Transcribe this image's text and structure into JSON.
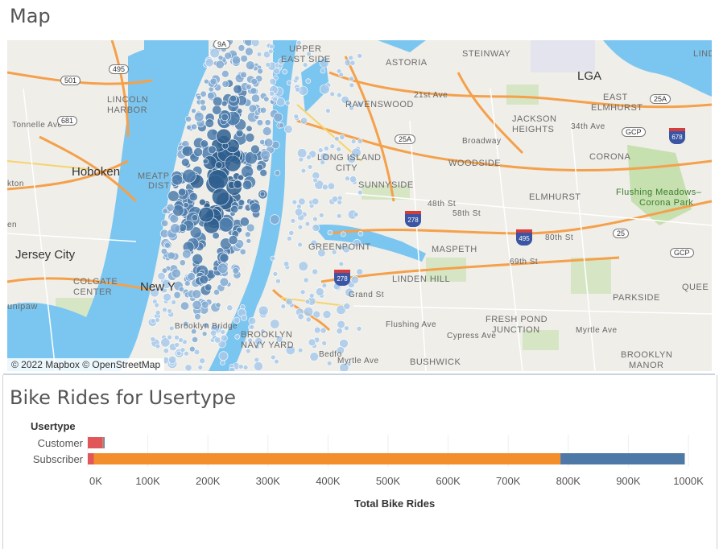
{
  "map_panel": {
    "title": "Map",
    "attribution": "© 2022 Mapbox © OpenStreetMap",
    "labels": [
      {
        "text": "STEINWAY",
        "x": 565,
        "y": 11,
        "style": ""
      },
      {
        "text": "LINDI",
        "x": 852,
        "y": 11,
        "style": ""
      },
      {
        "text": "ASTORIA",
        "x": 470,
        "y": 22,
        "style": ""
      },
      {
        "text": "UPPER",
        "x": 350,
        "y": 5,
        "style": ""
      },
      {
        "text": "EAST SIDE",
        "x": 340,
        "y": 18,
        "style": ""
      },
      {
        "text": "LGA",
        "x": 708,
        "y": 36,
        "style": "big"
      },
      {
        "text": "LINCOLN",
        "x": 124,
        "y": 68,
        "style": ""
      },
      {
        "text": "HARBOR",
        "x": 124,
        "y": 81,
        "style": ""
      },
      {
        "text": "RAVENSWOOD",
        "x": 420,
        "y": 74,
        "style": ""
      },
      {
        "text": "EAST",
        "x": 740,
        "y": 65,
        "style": ""
      },
      {
        "text": "ELMHURST",
        "x": 725,
        "y": 78,
        "style": ""
      },
      {
        "text": "JACKSON",
        "x": 627,
        "y": 92,
        "style": ""
      },
      {
        "text": "HEIGHTS",
        "x": 627,
        "y": 105,
        "style": ""
      },
      {
        "text": "34th Ave",
        "x": 700,
        "y": 102,
        "style": "street"
      },
      {
        "text": "Broadway",
        "x": 565,
        "y": 120,
        "style": "street"
      },
      {
        "text": "Hoboken",
        "x": 80,
        "y": 155,
        "style": "big"
      },
      {
        "text": "LONG ISLAND",
        "x": 385,
        "y": 140,
        "style": ""
      },
      {
        "text": "CITY",
        "x": 408,
        "y": 153,
        "style": ""
      },
      {
        "text": "WOODSIDE",
        "x": 548,
        "y": 147,
        "style": ""
      },
      {
        "text": "CORONA",
        "x": 723,
        "y": 139,
        "style": ""
      },
      {
        "text": "MEATP",
        "x": 162,
        "y": 163,
        "style": ""
      },
      {
        "text": "DIST",
        "x": 175,
        "y": 175,
        "style": ""
      },
      {
        "text": "SUNNYSIDE",
        "x": 436,
        "y": 174,
        "style": ""
      },
      {
        "text": "ELMHURST",
        "x": 648,
        "y": 189,
        "style": ""
      },
      {
        "text": "Flushing Meadows–",
        "x": 756,
        "y": 183,
        "style": "green"
      },
      {
        "text": "Corona Park",
        "x": 785,
        "y": 196,
        "style": "green"
      },
      {
        "text": "Jersey City",
        "x": 10,
        "y": 258,
        "style": "big"
      },
      {
        "text": "GREENPOINT",
        "x": 374,
        "y": 251,
        "style": ""
      },
      {
        "text": "MASPETH",
        "x": 527,
        "y": 254,
        "style": ""
      },
      {
        "text": "COLGATE",
        "x": 82,
        "y": 294,
        "style": ""
      },
      {
        "text": "CENTER",
        "x": 82,
        "y": 307,
        "style": ""
      },
      {
        "text": "LINDEN HILL",
        "x": 478,
        "y": 291,
        "style": ""
      },
      {
        "text": "PARKSIDE",
        "x": 752,
        "y": 314,
        "style": ""
      },
      {
        "text": "QUEE",
        "x": 838,
        "y": 301,
        "style": ""
      },
      {
        "text": "unipaw",
        "x": 0,
        "y": 325,
        "style": ""
      },
      {
        "text": "FRESH POND",
        "x": 594,
        "y": 341,
        "style": ""
      },
      {
        "text": "JUNCTION",
        "x": 602,
        "y": 354,
        "style": ""
      },
      {
        "text": "Myrtle Ave",
        "x": 706,
        "y": 355,
        "style": "street"
      },
      {
        "text": "Flushing Ave",
        "x": 470,
        "y": 348,
        "style": "street"
      },
      {
        "text": "Cypress Ave",
        "x": 546,
        "y": 362,
        "style": "street"
      },
      {
        "text": "BROOKLYN",
        "x": 290,
        "y": 360,
        "style": ""
      },
      {
        "text": "NAVY YARD",
        "x": 290,
        "y": 373,
        "style": ""
      },
      {
        "text": "BROOKLYN",
        "x": 762,
        "y": 385,
        "style": ""
      },
      {
        "text": "MANOR",
        "x": 772,
        "y": 398,
        "style": ""
      },
      {
        "text": "BUSHWICK",
        "x": 500,
        "y": 394,
        "style": ""
      },
      {
        "text": "Myrtle Ave",
        "x": 410,
        "y": 393,
        "style": "street"
      },
      {
        "text": "Brooklyn Bridge",
        "x": 208,
        "y": 350,
        "style": "street"
      },
      {
        "text": "Grand St",
        "x": 424,
        "y": 311,
        "style": "street"
      },
      {
        "text": "48th St",
        "x": 522,
        "y": 198,
        "style": "street"
      },
      {
        "text": "58th St",
        "x": 553,
        "y": 210,
        "style": "street"
      },
      {
        "text": "80th St",
        "x": 668,
        "y": 240,
        "style": "street"
      },
      {
        "text": "69th St",
        "x": 624,
        "y": 270,
        "style": "street"
      },
      {
        "text": "Tonnelle Ave",
        "x": 6,
        "y": 100,
        "style": "street"
      },
      {
        "text": "kton",
        "x": 0,
        "y": 173,
        "style": "street"
      },
      {
        "text": "en",
        "x": 0,
        "y": 224,
        "style": "street"
      },
      {
        "text": "New Y",
        "x": 165,
        "y": 298,
        "style": "big"
      },
      {
        "text": "Bedfo",
        "x": 387,
        "y": 385,
        "style": "street"
      },
      {
        "text": "21st Ave",
        "x": 505,
        "y": 63,
        "style": "street"
      }
    ],
    "shields": [
      {
        "text": "9A",
        "x": 256,
        "y": -1
      },
      {
        "text": "495",
        "x": 126,
        "y": 30
      },
      {
        "text": "501",
        "x": 66,
        "y": 44
      },
      {
        "text": "681",
        "x": 62,
        "y": 94
      },
      {
        "text": "25A",
        "x": 798,
        "y": 67
      },
      {
        "text": "GCP",
        "x": 763,
        "y": 108
      },
      {
        "text": "25A",
        "x": 481,
        "y": 117
      },
      {
        "text": "25",
        "x": 752,
        "y": 234
      },
      {
        "text": "GCP",
        "x": 823,
        "y": 258
      }
    ],
    "interstates": [
      {
        "text": "278",
        "x": 494,
        "y": 212
      },
      {
        "text": "495",
        "x": 632,
        "y": 235
      },
      {
        "text": "678",
        "x": 822,
        "y": 109
      },
      {
        "text": "278",
        "x": 406,
        "y": 285
      }
    ]
  },
  "chart_panel": {
    "title": "Bike Rides for Usertype",
    "legend_title": "Usertype"
  },
  "chart_data": {
    "type": "bar",
    "orientation": "horizontal",
    "stacked": true,
    "categories": [
      "Customer",
      "Subscriber"
    ],
    "series": [
      {
        "color": "#e15759",
        "values": [
          25000,
          10000
        ]
      },
      {
        "color": "#f28e2b",
        "values": [
          1000,
          777000
        ]
      },
      {
        "color": "#4e79a7",
        "values": [
          2000,
          207000
        ]
      }
    ],
    "xlabel": "Total Bike Rides",
    "xlim": [
      0,
      1000000
    ],
    "xticks": [
      "0K",
      "100K",
      "200K",
      "300K",
      "400K",
      "500K",
      "600K",
      "700K",
      "800K",
      "900K",
      "1000K"
    ],
    "grid": true
  }
}
